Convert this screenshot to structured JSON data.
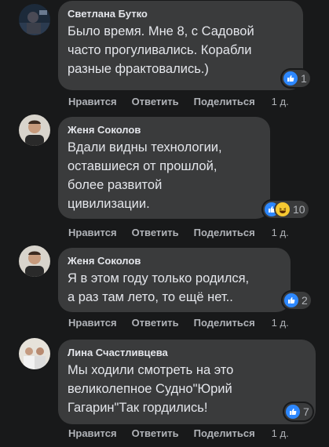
{
  "actions": {
    "like": "Нравится",
    "reply": "Ответить",
    "share": "Поделиться"
  },
  "comments": [
    {
      "author": "Светлана Бутко",
      "text": "Было время. Мне 8, с Садовой\nчасто прогуливались. Корабли\nразные фрактовались.)",
      "reactions_count": "1",
      "reaction_icons": [
        "like-icon"
      ],
      "time": "1 д."
    },
    {
      "author": "Женя Соколов",
      "text": "Вдали видны технологии,\nоставшиеся от прошлой,\nболее развитой\nцивилизации.",
      "reactions_count": "10",
      "reaction_icons": [
        "like-icon",
        "haha-icon"
      ],
      "time": "1 д."
    },
    {
      "author": "Женя Соколов",
      "text": "Я в этом году только родился,\nа раз там лето, то ещё нет..",
      "reactions_count": "2",
      "reaction_icons": [
        "like-icon"
      ],
      "time": "1 д."
    },
    {
      "author": "Лина Счастливцева",
      "text": "Мы ходили смотреть на это\nвеликолепное Судно\"Юрий\nГагарин\"Так гордились!",
      "reactions_count": "7",
      "reaction_icons": [
        "like-icon"
      ],
      "time": "1 д."
    }
  ],
  "colors": {
    "background": "#18191a",
    "bubble": "#3a3b3c",
    "like": "#2d88ff",
    "haha": "#f7c932",
    "secondary_text": "#b0b3b8"
  }
}
